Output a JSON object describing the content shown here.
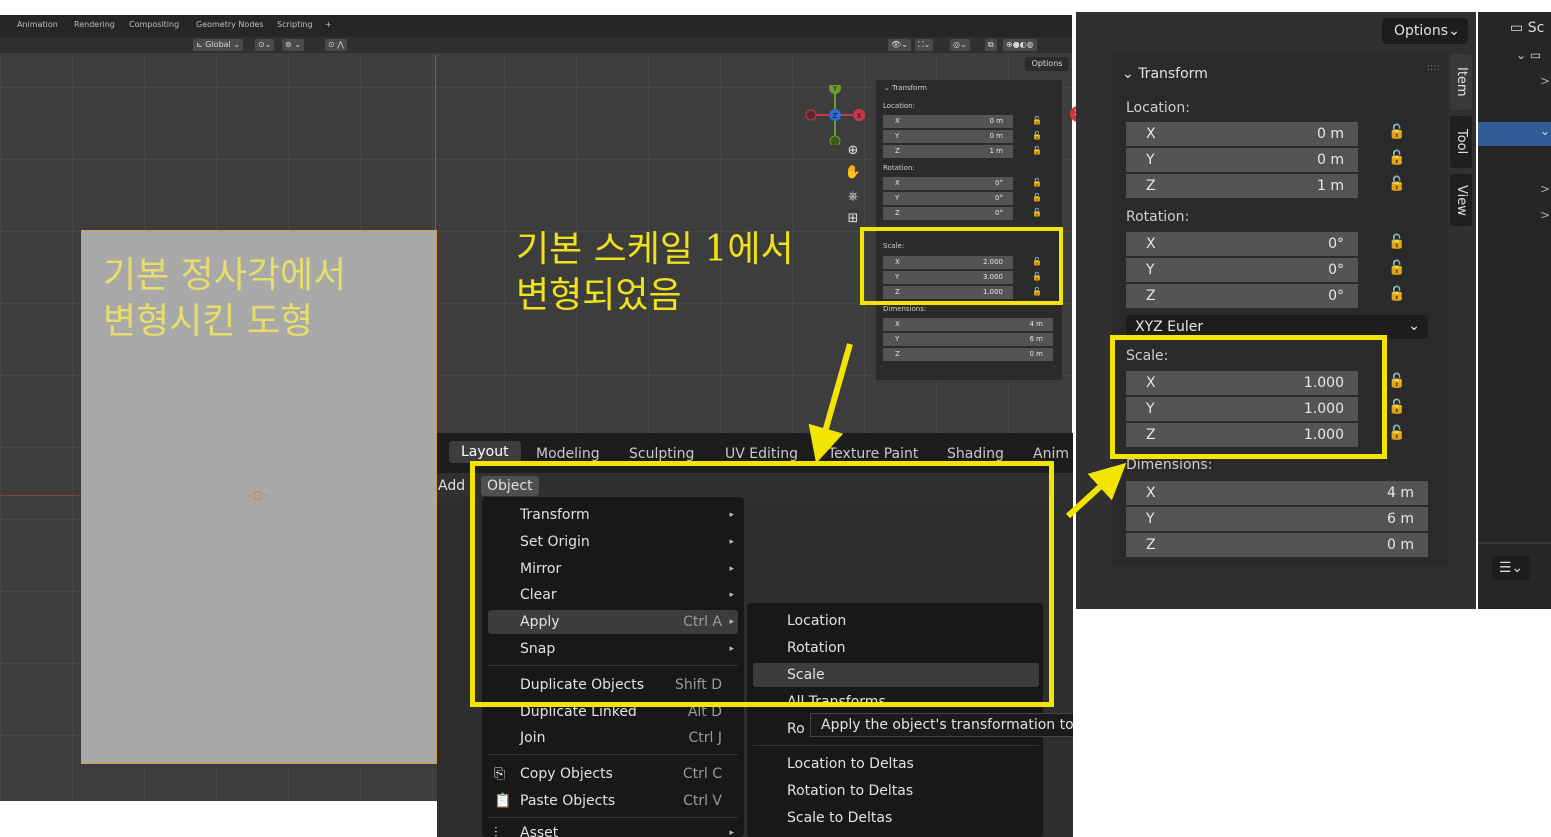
{
  "viewport": {
    "workspace_tabs": [
      "Animation",
      "Rendering",
      "Compositing",
      "Geometry Nodes",
      "Scripting",
      "+"
    ],
    "orientation": "Global",
    "options_label": "Options",
    "rect_annotation": "기본 정사각에서\n변형시킨 도형",
    "note_annotation": "기본 스케일 1에서\n변형되었음",
    "gizmo": {
      "x": "X",
      "y": "Y",
      "z": "Z"
    },
    "mini_transform": {
      "title": "Transform",
      "location_label": "Location:",
      "rotation_label": "Rotation:",
      "scale_label": "Scale:",
      "dimensions_label": "Dimensions:",
      "location": [
        {
          "k": "X",
          "v": "0 m"
        },
        {
          "k": "Y",
          "v": "0 m"
        },
        {
          "k": "Z",
          "v": "1 m"
        }
      ],
      "rotation": [
        {
          "k": "X",
          "v": "0°"
        },
        {
          "k": "Y",
          "v": "0°"
        },
        {
          "k": "Z",
          "v": "0°"
        }
      ],
      "scale": [
        {
          "k": "X",
          "v": "2.000"
        },
        {
          "k": "Y",
          "v": "3.000"
        },
        {
          "k": "Z",
          "v": "1.000"
        }
      ],
      "dimensions": [
        {
          "k": "X",
          "v": "4 m"
        },
        {
          "k": "Y",
          "v": "6 m"
        },
        {
          "k": "Z",
          "v": "0 m"
        }
      ]
    }
  },
  "menu": {
    "workspace_tabs": [
      "Layout",
      "Modeling",
      "Sculpting",
      "UV Editing",
      "Texture Paint",
      "Shading",
      "Anim"
    ],
    "add_label": "Add",
    "object_label": "Object",
    "object_items": [
      {
        "label": "Transform",
        "shortcut": "",
        "arrow": "▸"
      },
      {
        "label": "Set Origin",
        "shortcut": "",
        "arrow": "▸"
      },
      {
        "label": "Mirror",
        "shortcut": "",
        "arrow": "▸"
      },
      {
        "label": "Clear",
        "shortcut": "",
        "arrow": "▸"
      },
      {
        "label": "Apply",
        "shortcut": "Ctrl A",
        "arrow": "▸"
      },
      {
        "label": "Snap",
        "shortcut": "",
        "arrow": "▸"
      },
      {
        "label": "Duplicate Objects",
        "shortcut": "Shift D",
        "arrow": ""
      },
      {
        "label": "Duplicate Linked",
        "shortcut": "Alt D",
        "arrow": ""
      },
      {
        "label": "Join",
        "shortcut": "Ctrl J",
        "arrow": ""
      },
      {
        "label": "Copy Objects",
        "shortcut": "Ctrl C",
        "arrow": ""
      },
      {
        "label": "Paste Objects",
        "shortcut": "Ctrl V",
        "arrow": ""
      },
      {
        "label": "Asset",
        "shortcut": "",
        "arrow": "▸"
      }
    ],
    "apply_items": [
      "Location",
      "Rotation",
      "Scale",
      "All Transforms",
      "Ro",
      "Location to Deltas",
      "Rotation to Deltas",
      "Scale to Deltas"
    ],
    "tooltip": "Apply the object's transformation to its data"
  },
  "npanel": {
    "options_label": "Options",
    "title": "Transform",
    "location_label": "Location:",
    "rotation_label": "Rotation:",
    "scale_label": "Scale:",
    "dimensions_label": "Dimensions:",
    "rotation_mode": "XYZ Euler",
    "location": [
      {
        "k": "X",
        "v": "0 m"
      },
      {
        "k": "Y",
        "v": "0 m"
      },
      {
        "k": "Z",
        "v": "1 m"
      }
    ],
    "rotation": [
      {
        "k": "X",
        "v": "0°"
      },
      {
        "k": "Y",
        "v": "0°"
      },
      {
        "k": "Z",
        "v": "0°"
      }
    ],
    "scale": [
      {
        "k": "X",
        "v": "1.000"
      },
      {
        "k": "Y",
        "v": "1.000"
      },
      {
        "k": "Z",
        "v": "1.000"
      }
    ],
    "dimensions": [
      {
        "k": "X",
        "v": "4 m"
      },
      {
        "k": "Y",
        "v": "6 m"
      },
      {
        "k": "Z",
        "v": "0 m"
      }
    ],
    "side_tabs": [
      "Item",
      "Tool",
      "View"
    ]
  },
  "outliner": {
    "header_fragment": "Sc"
  },
  "colors": {
    "highlight_box": "#f2e500",
    "viewport_bg": "#3d3d3d",
    "selection": "#335b95"
  }
}
